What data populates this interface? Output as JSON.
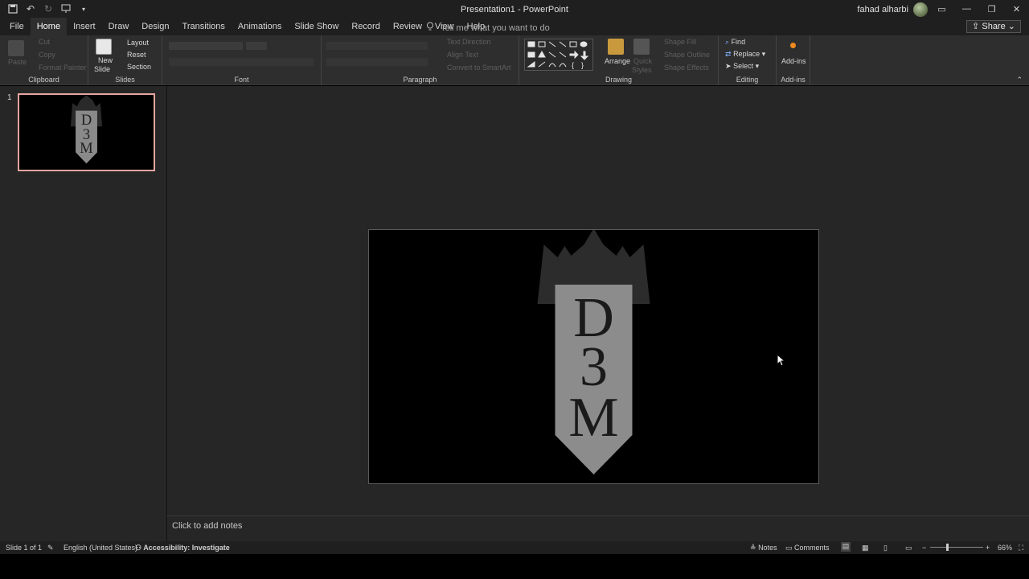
{
  "titlebar": {
    "title": "Presentation1  -  PowerPoint",
    "username": "fahad alharbi"
  },
  "tabs": [
    "File",
    "Home",
    "Insert",
    "Draw",
    "Design",
    "Transitions",
    "Animations",
    "Slide Show",
    "Record",
    "Review",
    "View",
    "Help"
  ],
  "tellme": "Tell me what you want to do",
  "share": "Share",
  "ribbon": {
    "clipboard": {
      "label": "Clipboard",
      "paste": "Paste",
      "cut": "Cut",
      "copy": "Copy",
      "format_painter": "Format Painter"
    },
    "slides": {
      "label": "Slides",
      "new_slide": "New",
      "new_slide2": "Slide",
      "layout": "Layout",
      "reset": "Reset",
      "section": "Section"
    },
    "font": {
      "label": "Font"
    },
    "paragraph": {
      "label": "Paragraph",
      "text_direction": "Text Direction",
      "align_text": "Align Text",
      "convert_smartart": "Convert to SmartArt"
    },
    "drawing": {
      "label": "Drawing",
      "arrange": "Arrange",
      "quick_styles": "Quick",
      "quick_styles2": "Styles",
      "shape_fill": "Shape Fill",
      "shape_outline": "Shape Outline",
      "shape_effects": "Shape Effects"
    },
    "editing": {
      "label": "Editing",
      "find": "Find",
      "replace": "Replace",
      "select": "Select"
    },
    "addins": {
      "label": "Add-ins",
      "button": "Add-ins"
    }
  },
  "slide_panel": {
    "number": "1"
  },
  "slide": {
    "letters": [
      "D",
      "3",
      "M"
    ]
  },
  "notes": {
    "placeholder": "Click to add notes"
  },
  "status": {
    "slide_of": "Slide 1 of 1",
    "language": "English (United States)",
    "accessibility": "Accessibility: Investigate",
    "notes": "Notes",
    "comments": "Comments",
    "zoom": "66%"
  }
}
